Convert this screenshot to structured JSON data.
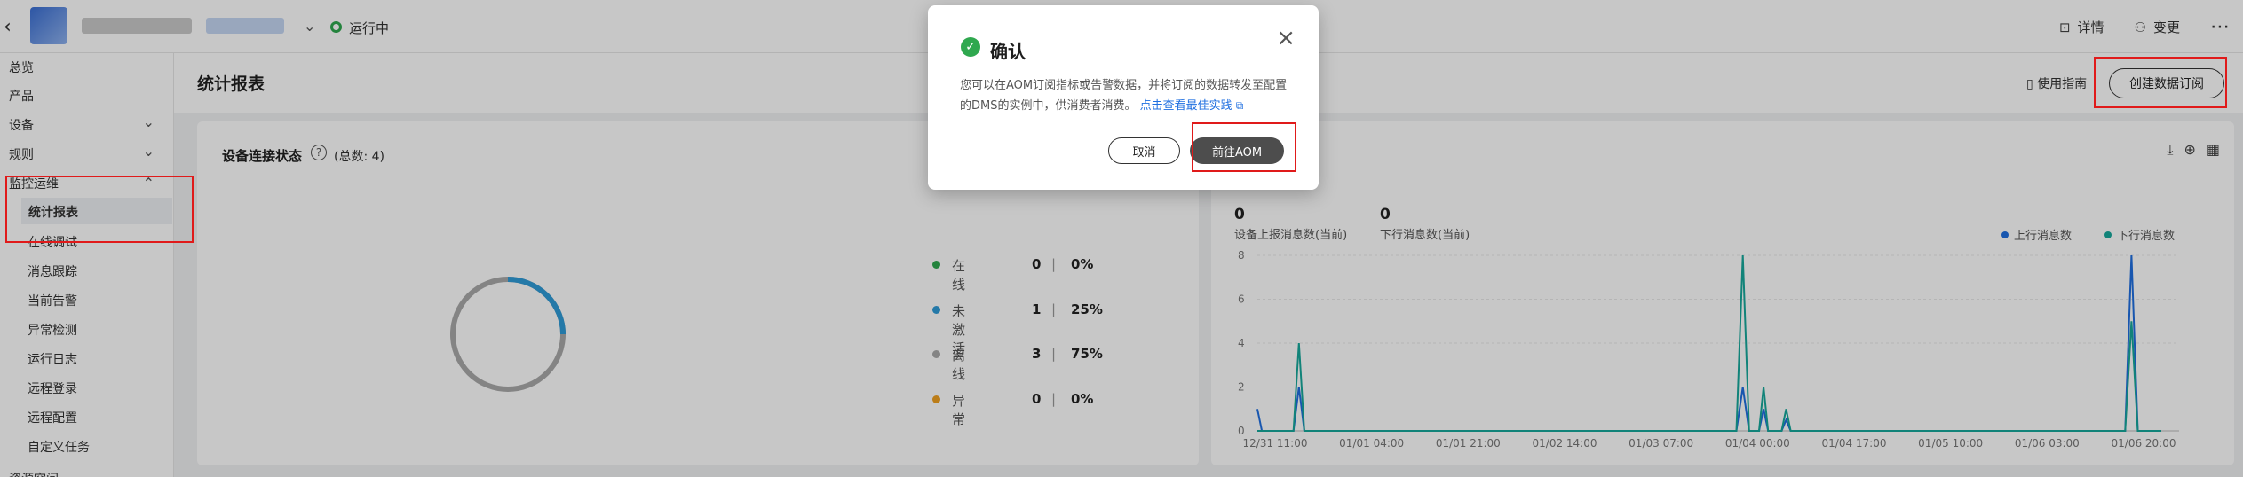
{
  "topbar": {
    "back_icon": "chevron-left-icon",
    "status_text": "运行中",
    "details_label": "详情",
    "change_label": "变更",
    "more_icon": "more-icon"
  },
  "sidebar": {
    "items": [
      {
        "label": "总览"
      },
      {
        "label": "产品"
      },
      {
        "label": "设备"
      },
      {
        "label": "规则"
      },
      {
        "label": "监控运维"
      },
      {
        "label": "统计报表"
      },
      {
        "label": "在线调试"
      },
      {
        "label": "消息跟踪"
      },
      {
        "label": "当前告警"
      },
      {
        "label": "异常检测"
      },
      {
        "label": "运行日志"
      },
      {
        "label": "远程登录"
      },
      {
        "label": "远程配置"
      },
      {
        "label": "自定义任务"
      },
      {
        "label": "资源空间"
      }
    ]
  },
  "page": {
    "title": "统计报表",
    "guide_label": "使用指南",
    "create_button": "创建数据订阅"
  },
  "device_status": {
    "title": "设备连接状态",
    "total": "(总数: 4)",
    "legend": [
      {
        "name": "在线",
        "count": "0",
        "sep": "|",
        "pct": "0%",
        "color": "#2fa84f"
      },
      {
        "name": "未激活",
        "count": "1",
        "sep": "|",
        "pct": "25%",
        "color": "#2f9bd8"
      },
      {
        "name": "离线",
        "count": "3",
        "sep": "|",
        "pct": "75%",
        "color": "#a9a9a9"
      },
      {
        "name": "异常",
        "count": "0",
        "sep": "|",
        "pct": "0%",
        "color": "#f0a020"
      }
    ]
  },
  "messages": {
    "up_value": "0",
    "up_label": "设备上报消息数(当前)",
    "down_value": "0",
    "down_label": "下行消息数(当前)"
  },
  "chart_data": {
    "type": "line",
    "x": [
      "12/31 11:00",
      "01/01 04:00",
      "01/01 21:00",
      "01/02 14:00",
      "01/03 07:00",
      "01/04 00:00",
      "01/04 17:00",
      "01/05 10:00",
      "01/06 03:00",
      "01/06 20:00"
    ],
    "xlim": [
      0,
      100
    ],
    "ylim": [
      0,
      8
    ],
    "yticks": [
      "0",
      "2",
      "4",
      "6",
      "8"
    ],
    "series": [
      {
        "name": "上行消息数",
        "color": "#1f6fe0",
        "points": [
          [
            0,
            1
          ],
          [
            0.5,
            0
          ],
          [
            4,
            0
          ],
          [
            4.6,
            2
          ],
          [
            5.2,
            0
          ],
          [
            53,
            0
          ],
          [
            53.7,
            2
          ],
          [
            54.4,
            0
          ],
          [
            55.5,
            0
          ],
          [
            56,
            1
          ],
          [
            56.5,
            0
          ],
          [
            58,
            0
          ],
          [
            58.5,
            0.5
          ],
          [
            59,
            0
          ],
          [
            96,
            0
          ],
          [
            96.7,
            8
          ],
          [
            97.4,
            0
          ],
          [
            100,
            0
          ]
        ]
      },
      {
        "name": "下行消息数",
        "color": "#16a89b",
        "points": [
          [
            0,
            0
          ],
          [
            4,
            0
          ],
          [
            4.6,
            4
          ],
          [
            5.2,
            0
          ],
          [
            53,
            0
          ],
          [
            53.7,
            8
          ],
          [
            54.4,
            0
          ],
          [
            55.5,
            0
          ],
          [
            56,
            2
          ],
          [
            56.5,
            0
          ],
          [
            58,
            0
          ],
          [
            58.5,
            1
          ],
          [
            59,
            0
          ],
          [
            96,
            0
          ],
          [
            96.7,
            5
          ],
          [
            97.4,
            0
          ],
          [
            100,
            0
          ]
        ]
      }
    ]
  },
  "modal": {
    "title": "确认",
    "body": "您可以在AOM订阅指标或告警数据，并将订阅的数据转发至配置的DMS的实例中，供消费者消费。",
    "link_text": "点击查看最佳实践",
    "cancel_label": "取消",
    "go_label": "前往AOM"
  }
}
